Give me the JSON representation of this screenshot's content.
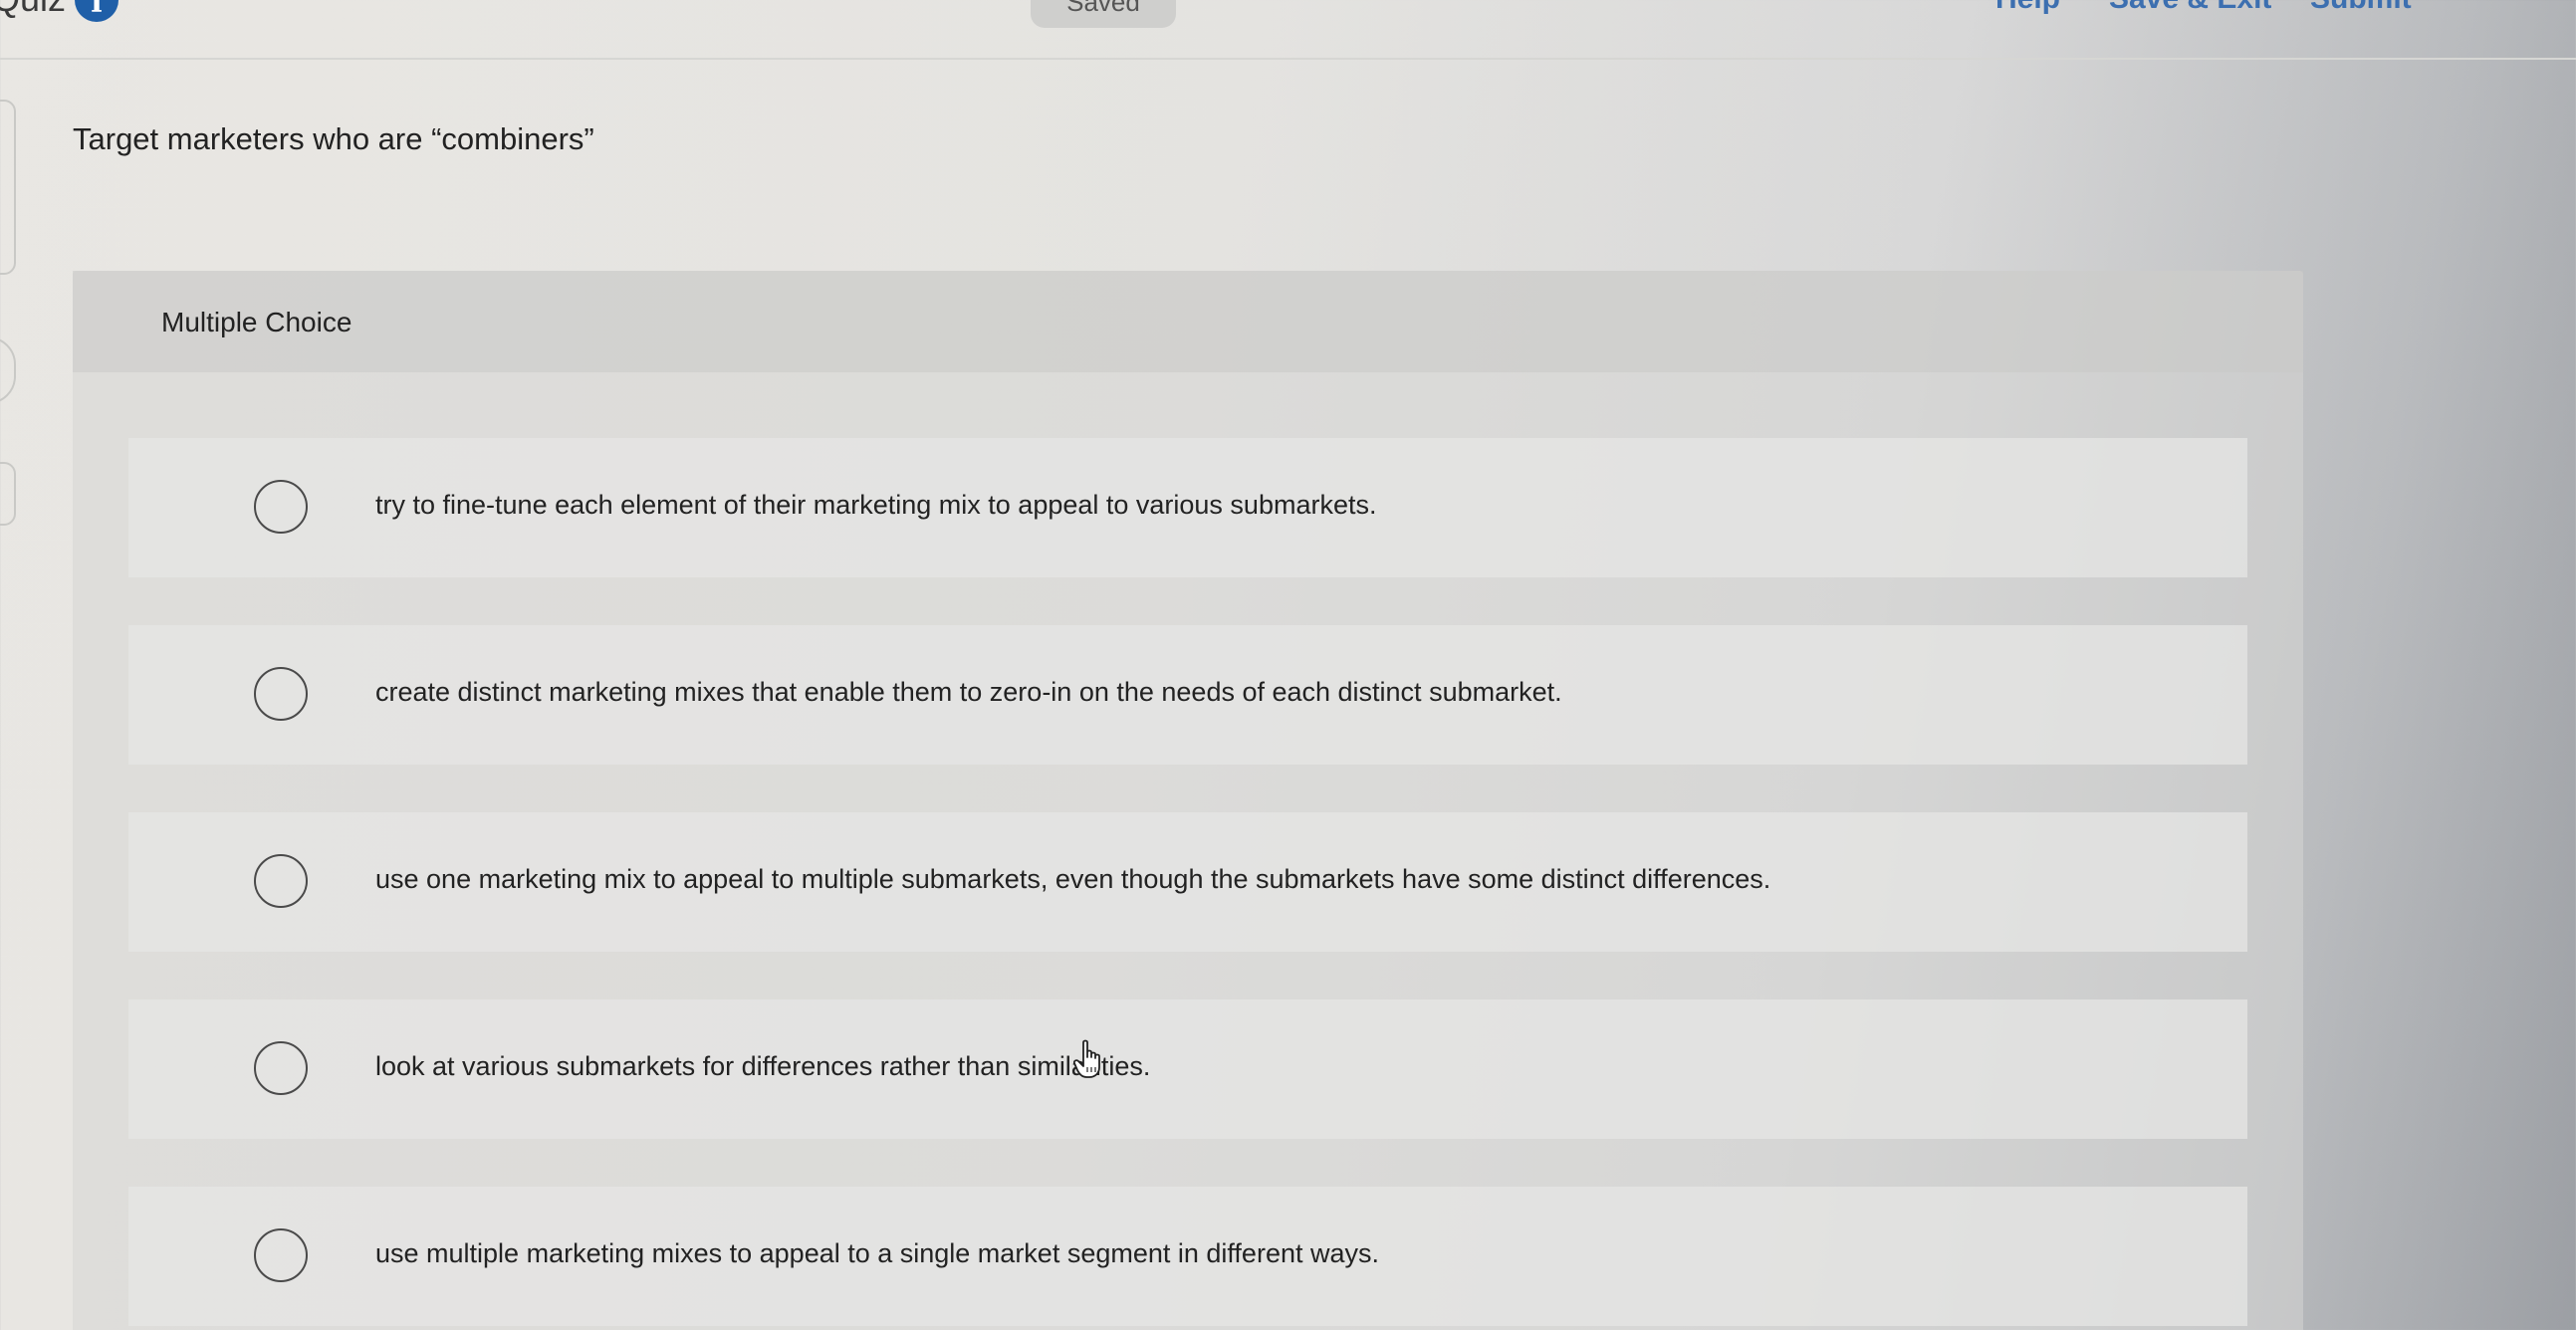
{
  "header": {
    "title": "Quiz",
    "info_icon": "info-icon",
    "status": "Saved",
    "links": {
      "help": "Help",
      "save_exit": "Save & Exit",
      "submit": "Submit"
    }
  },
  "question": {
    "prompt": "Target marketers who are “combiners”",
    "type_label": "Multiple Choice",
    "options": [
      "try to fine-tune each element of their marketing mix to appeal to various submarkets.",
      "create distinct marketing mixes that enable them to zero-in on the needs of each distinct submarket.",
      "use one marketing mix to appeal to multiple submarkets, even though the submarkets have some distinct differences.",
      "look at various submarkets for differences rather than similarities.",
      "use multiple marketing mixes to appeal to a single market segment in different ways."
    ]
  },
  "colors": {
    "accent": "#1f5fa8",
    "link": "#3c6fb0"
  }
}
